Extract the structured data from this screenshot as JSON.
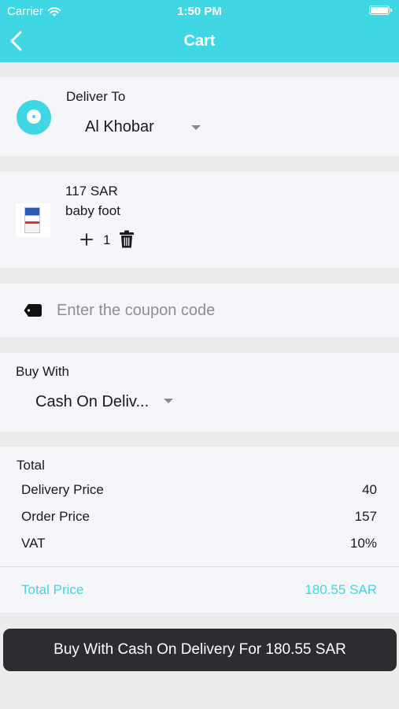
{
  "status_bar": {
    "carrier": "Carrier",
    "time": "1:50 PM"
  },
  "nav": {
    "title": "Cart"
  },
  "delivery": {
    "label": "Deliver To",
    "city": "Al Khobar"
  },
  "cart_item": {
    "price": "117 SAR",
    "name": "baby foot",
    "quantity": "1"
  },
  "coupon": {
    "placeholder": "Enter the coupon code"
  },
  "payment": {
    "label": "Buy With",
    "method": "Cash On Deliv..."
  },
  "totals": {
    "heading": "Total",
    "rows": [
      {
        "label": "Delivery Price",
        "value": "40"
      },
      {
        "label": "Order Price",
        "value": "157"
      },
      {
        "label": "VAT",
        "value": "10%"
      }
    ],
    "total_label": "Total Price",
    "total_value": "180.55 SAR"
  },
  "checkout_button": {
    "label": "Buy With Cash On Delivery For 180.55 SAR"
  },
  "colors": {
    "accent": "#3fd7e4",
    "button": "#2b2d31",
    "background": "#ececec",
    "card": "#f5f6f9"
  }
}
